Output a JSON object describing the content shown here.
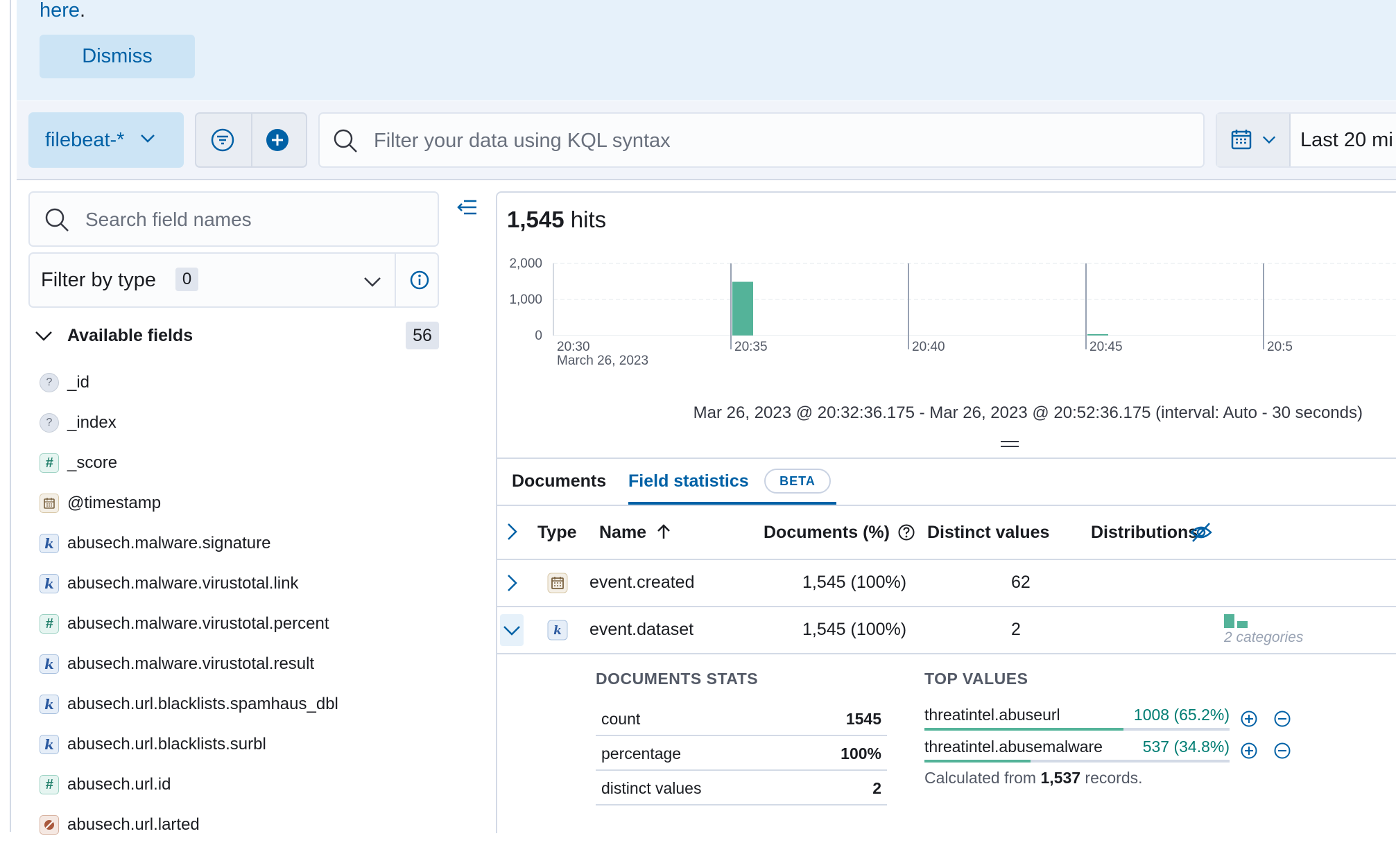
{
  "callout": {
    "link_text": "here",
    "trailing": ".",
    "dismiss_label": "Dismiss"
  },
  "query_bar": {
    "data_view": "filebeat-*",
    "kql_placeholder": "Filter your data using KQL syntax",
    "date_label": "Last 20 mi"
  },
  "sidebar": {
    "search_placeholder": "Search field names",
    "filter_by_type_label": "Filter by type",
    "filter_count": "0",
    "available_fields_label": "Available fields",
    "available_count": "56",
    "fields": [
      {
        "name": "_id",
        "type": "unknown"
      },
      {
        "name": "_index",
        "type": "unknown"
      },
      {
        "name": "_score",
        "type": "number"
      },
      {
        "name": "@timestamp",
        "type": "date"
      },
      {
        "name": "abusech.malware.signature",
        "type": "keyword"
      },
      {
        "name": "abusech.malware.virustotal.link",
        "type": "keyword"
      },
      {
        "name": "abusech.malware.virustotal.percent",
        "type": "number"
      },
      {
        "name": "abusech.malware.virustotal.result",
        "type": "keyword"
      },
      {
        "name": "abusech.url.blacklists.spamhaus_dbl",
        "type": "keyword"
      },
      {
        "name": "abusech.url.blacklists.surbl",
        "type": "keyword"
      },
      {
        "name": "abusech.url.id",
        "type": "number"
      },
      {
        "name": "abusech.url.larted",
        "type": "geo"
      }
    ]
  },
  "hits": {
    "count": "1,545",
    "label": "hits"
  },
  "chart_data": {
    "type": "bar",
    "y_ticks": [
      "2,000",
      "1,000",
      "0"
    ],
    "ylim": [
      0,
      2000
    ],
    "x_ticks": [
      "20:30",
      "20:35",
      "20:40",
      "20:45",
      "20:5"
    ],
    "x_date_label": "March 26, 2023",
    "bars": [
      {
        "time": "20:35",
        "value": 1490
      },
      {
        "time": "20:45",
        "value": 40
      }
    ],
    "bar_color": "#54b399"
  },
  "time_range": "Mar 26, 2023 @ 20:32:36.175 - Mar 26, 2023 @ 20:52:36.175 (interval: Auto - 30 seconds)",
  "tabs": {
    "documents": "Documents",
    "field_statistics": "Field statistics",
    "beta": "BETA"
  },
  "table": {
    "headers": {
      "type": "Type",
      "name": "Name",
      "documents": "Documents (%)",
      "distinct": "Distinct values",
      "distributions": "Distributions"
    },
    "rows": [
      {
        "type": "date",
        "name": "event.created",
        "documents": "1,545 (100%)",
        "distinct": "62",
        "distribution": ""
      },
      {
        "type": "keyword",
        "name": "event.dataset",
        "documents": "1,545 (100%)",
        "distinct": "2",
        "distribution": "2 categories"
      }
    ]
  },
  "expanded": {
    "docs_stats_title": "DOCUMENTS STATS",
    "stats": [
      {
        "label": "count",
        "value": "1545"
      },
      {
        "label": "percentage",
        "value": "100%"
      },
      {
        "label": "distinct values",
        "value": "2"
      }
    ],
    "top_values_title": "TOP VALUES",
    "top_values": [
      {
        "value": "threatintel.abuseurl",
        "pct": "1008 (65.2%)",
        "fraction": 0.652
      },
      {
        "value": "threatintel.abusemalware",
        "pct": "537 (34.8%)",
        "fraction": 0.348
      }
    ],
    "calc_prefix": "Calculated from",
    "calc_count": "1,537",
    "calc_suffix": "records."
  },
  "colors": {
    "accent": "#0061a6",
    "bar": "#54b399",
    "callout_bg": "#e6f1fa"
  }
}
